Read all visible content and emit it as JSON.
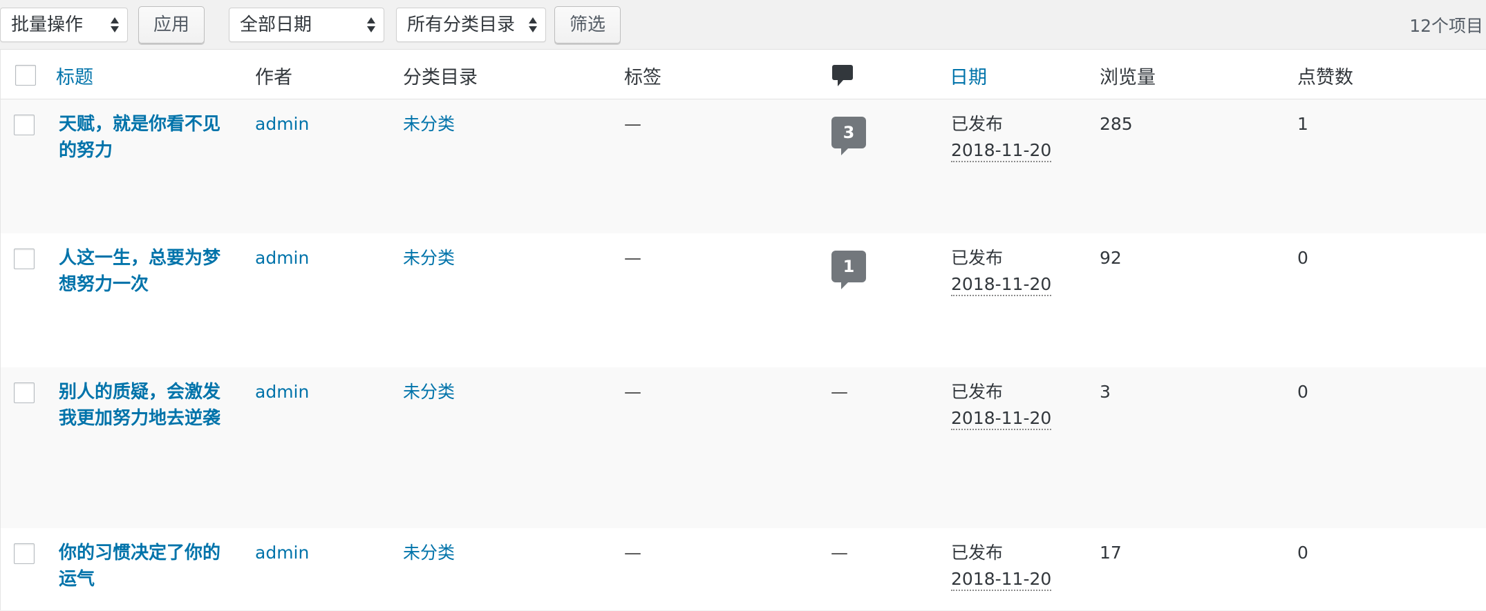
{
  "toolbar": {
    "bulk_action": "批量操作",
    "apply_label": "应用",
    "date_filter": "全部日期",
    "category_filter": "所有分类目录",
    "filter_label": "筛选",
    "item_count": "12个项目"
  },
  "table": {
    "headers": {
      "title": "标题",
      "author": "作者",
      "categories": "分类目录",
      "tags": "标签",
      "comments_icon": "comment-bubble-icon",
      "date": "日期",
      "views": "浏览量",
      "likes": "点赞数"
    },
    "rows": [
      {
        "title": "天赋，就是你看不见的努力",
        "author": "admin",
        "category": "未分类",
        "tags": "—",
        "comments": "3",
        "status": "已发布",
        "date": "2018-11-20",
        "views": "285",
        "likes": "1"
      },
      {
        "title": "人这一生，总要为梦想努力一次",
        "author": "admin",
        "category": "未分类",
        "tags": "—",
        "comments": "1",
        "status": "已发布",
        "date": "2018-11-20",
        "views": "92",
        "likes": "0"
      },
      {
        "title": "别人的质疑，会激发我更加努力地去逆袭",
        "author": "admin",
        "category": "未分类",
        "tags": "—",
        "comments": "—",
        "status": "已发布",
        "date": "2018-11-20",
        "views": "3",
        "likes": "0"
      },
      {
        "title": "你的习惯决定了你的运气",
        "author": "admin",
        "category": "未分类",
        "tags": "—",
        "comments": "—",
        "status": "已发布",
        "date": "2018-11-20",
        "views": "17",
        "likes": "0"
      }
    ]
  },
  "colors": {
    "link": "#0073aa",
    "bubble": "#72777c",
    "alt_row": "#f9f9f9"
  }
}
